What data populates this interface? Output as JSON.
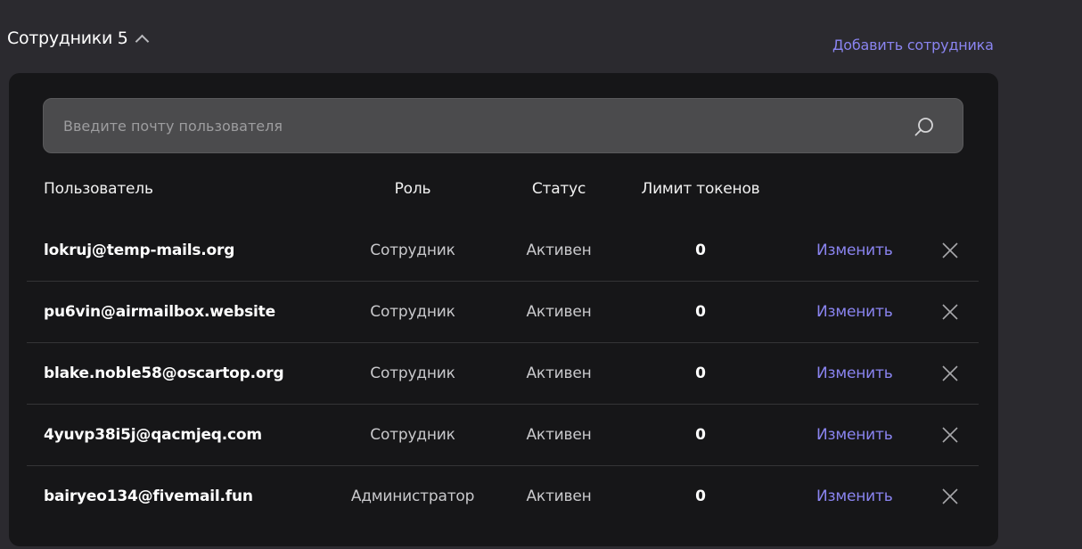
{
  "header": {
    "title": "Сотрудники 5",
    "add_link": "Добавить сотрудника"
  },
  "search": {
    "placeholder": "Введите почту пользователя",
    "icon": "search-icon"
  },
  "table": {
    "columns": [
      "Пользователь",
      "Роль",
      "Статус",
      "Лимит токенов"
    ],
    "rows": [
      {
        "email": "lokruj@temp-mails.org",
        "role": "Сотрудник",
        "status": "Активен",
        "limit": "0",
        "edit": "Изменить"
      },
      {
        "email": "pu6vin@airmailbox.website",
        "role": "Сотрудник",
        "status": "Активен",
        "limit": "0",
        "edit": "Изменить"
      },
      {
        "email": "blake.noble58@oscartop.org",
        "role": "Сотрудник",
        "status": "Активен",
        "limit": "0",
        "edit": "Изменить"
      },
      {
        "email": "4yuvp38i5j@qacmjeq.com",
        "role": "Сотрудник",
        "status": "Активен",
        "limit": "0",
        "edit": "Изменить"
      },
      {
        "email": "bairyeo134@fivemail.fun",
        "role": "Администратор",
        "status": "Активен",
        "limit": "0",
        "edit": "Изменить"
      }
    ]
  },
  "colors": {
    "accent": "#8a84f0",
    "background": "#2b2a2f",
    "card": "#161618",
    "search_bg": "#4b4b4d"
  }
}
